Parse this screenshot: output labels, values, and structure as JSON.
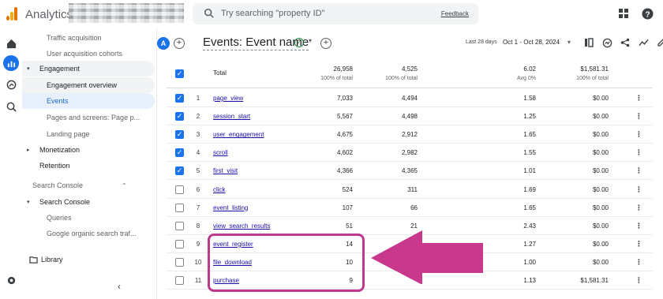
{
  "app": {
    "title": "Analytics"
  },
  "search": {
    "placeholder": "Try searching \"property ID\"",
    "feedback": "Feedback"
  },
  "nav": {
    "items": [
      {
        "label": "Traffic acquisition",
        "type": "sub"
      },
      {
        "label": "User acquisition cohorts",
        "type": "sub"
      },
      {
        "label": "Engagement",
        "type": "group"
      },
      {
        "label": "Engagement overview",
        "type": "sub"
      },
      {
        "label": "Events",
        "type": "selected"
      },
      {
        "label": "Pages and screens: Page p...",
        "type": "sub"
      },
      {
        "label": "Landing page",
        "type": "sub"
      },
      {
        "label": "Monetization",
        "type": "collapsed"
      },
      {
        "label": "Retention",
        "type": "plain"
      },
      {
        "label": "Search Console",
        "type": "section"
      },
      {
        "label": "Search Console",
        "type": "group-open"
      },
      {
        "label": "Queries",
        "type": "sub"
      },
      {
        "label": "Google organic search traf...",
        "type": "sub"
      },
      {
        "label": "Library",
        "type": "library"
      }
    ]
  },
  "report": {
    "avatar": "A",
    "title": "Events: Event name",
    "date_label": "Last 28 days",
    "date_range": "Oct 1 - Oct 28, 2024"
  },
  "table": {
    "header": {
      "label": "Total",
      "c1": "26,958",
      "c1_sub": "100% of total",
      "c2": "4,525",
      "c2_sub": "100% of total",
      "c3": "6.02",
      "c3_sub": "Avg 0%",
      "c4": "$1,581.31",
      "c4_sub": "100% of total"
    },
    "rows": [
      {
        "idx": "1",
        "event": "page_view",
        "c1": "7,033",
        "c2": "4,494",
        "c3": "1.58",
        "c4": "$0.00",
        "checked": true
      },
      {
        "idx": "2",
        "event": "session_start",
        "c1": "5,567",
        "c2": "4,498",
        "c3": "1.25",
        "c4": "$0.00",
        "checked": true
      },
      {
        "idx": "3",
        "event": "user_engagement",
        "c1": "4,675",
        "c2": "2,912",
        "c3": "1.65",
        "c4": "$0.00",
        "checked": true
      },
      {
        "idx": "4",
        "event": "scroll",
        "c1": "4,602",
        "c2": "2,982",
        "c3": "1.55",
        "c4": "$0.00",
        "checked": true
      },
      {
        "idx": "5",
        "event": "first_visit",
        "c1": "4,366",
        "c2": "4,365",
        "c3": "1.01",
        "c4": "$0.00",
        "checked": true
      },
      {
        "idx": "6",
        "event": "click",
        "c1": "524",
        "c2": "311",
        "c3": "1.69",
        "c4": "$0.00",
        "checked": false
      },
      {
        "idx": "7",
        "event": "event_listing",
        "c1": "107",
        "c2": "66",
        "c3": "1.65",
        "c4": "$0.00",
        "checked": false
      },
      {
        "idx": "8",
        "event": "view_search_results",
        "c1": "51",
        "c2": "21",
        "c3": "2.43",
        "c4": "$0.00",
        "checked": false
      },
      {
        "idx": "9",
        "event": "event_register",
        "c1": "14",
        "c2": "",
        "c3": "1.27",
        "c4": "$0.00",
        "checked": false
      },
      {
        "idx": "10",
        "event": "file_download",
        "c1": "10",
        "c2": "",
        "c3": "1.00",
        "c4": "$0.00",
        "checked": false
      },
      {
        "idx": "11",
        "event": "purchase",
        "c1": "9",
        "c2": "",
        "c3": "1.13",
        "c4": "$1,581.31",
        "checked": false
      }
    ]
  },
  "colors": {
    "accent": "#1a73e8",
    "highlight": "#bc3a8b",
    "arrow": "#c8388d"
  }
}
